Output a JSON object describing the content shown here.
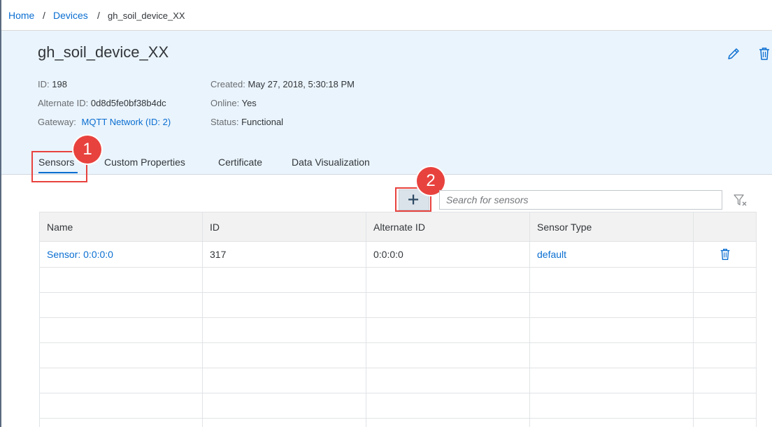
{
  "breadcrumb": {
    "home": "Home",
    "separator": "/",
    "devices": "Devices",
    "current": "gh_soil_device_XX"
  },
  "device": {
    "title": "gh_soil_device_XX",
    "id_label": "ID:",
    "id_value": "198",
    "alt_id_label": "Alternate ID:",
    "alt_id_value": "0d8d5fe0bf38b4dc",
    "gateway_label": "Gateway:",
    "gateway_value": "MQTT Network (ID: 2)",
    "created_label": "Created:",
    "created_value": "May 27, 2018, 5:30:18 PM",
    "online_label": "Online:",
    "online_value": "Yes",
    "status_label": "Status:",
    "status_value": "Functional"
  },
  "header_icons": [
    "edit-icon",
    "trash-icon"
  ],
  "tabs": [
    {
      "label": "Sensors",
      "active": true
    },
    {
      "label": "Custom Properties",
      "active": false
    },
    {
      "label": "Certificate",
      "active": false
    },
    {
      "label": "Data Visualization",
      "active": false
    }
  ],
  "annotations": {
    "badge_1": "1",
    "badge_2": "2",
    "color": "#e8423e"
  },
  "toolbar": {
    "add_icon": "plus-icon",
    "search_placeholder": "Search for sensors",
    "filter_icon": "clear-filter-icon"
  },
  "table": {
    "columns": [
      "Name",
      "ID",
      "Alternate ID",
      "Sensor Type",
      ""
    ],
    "rows": [
      {
        "name": "Sensor: 0:0:0:0",
        "id": "317",
        "alt_id": "0:0:0:0",
        "type": "default",
        "action_icon": "trash-icon"
      }
    ]
  },
  "colors": {
    "accent": "#0a6ed1",
    "header_bg": "#eaf4fc",
    "annotation": "#e8423e"
  }
}
